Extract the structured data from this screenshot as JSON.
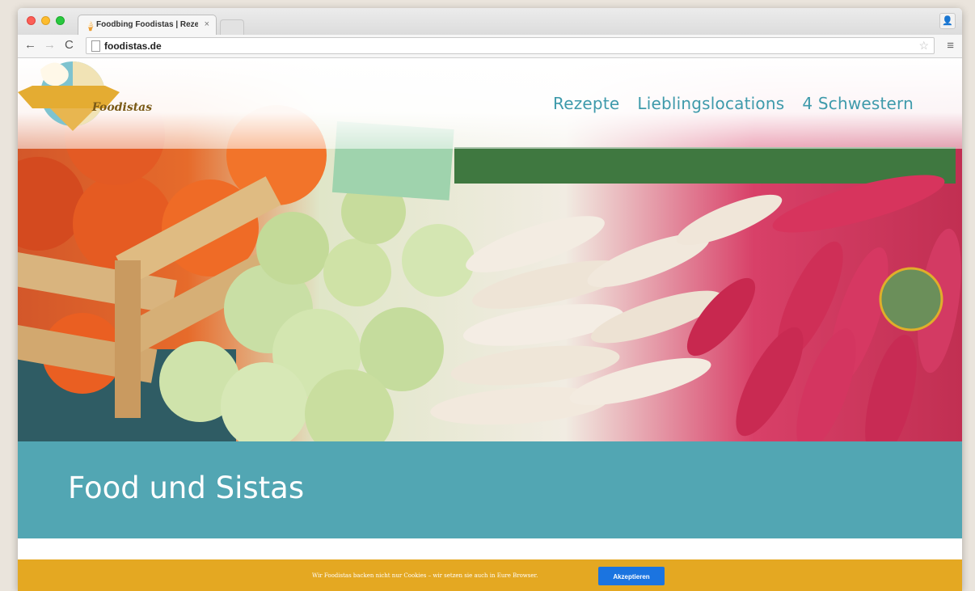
{
  "browser": {
    "tab_title": "Foodbing Foodistas | Rezepte",
    "tab_close": "×",
    "favicon": "🍦",
    "url": "foodistas.de",
    "icons": [
      "back-arrow-icon",
      "forward-arrow-icon",
      "reload-icon",
      "page-icon",
      "star-icon",
      "menu-icon",
      "profile-icon"
    ]
  },
  "site": {
    "logo_text": "Foodistas",
    "nav": [
      "Rezepte",
      "Lieblingslocations",
      "4 Schwestern"
    ],
    "page_title": "Food und Sistas",
    "colors": {
      "teal": "#52a6b3",
      "nav": "#3e9aab",
      "cookie_bar": "#e4a822",
      "button": "#1b74e0"
    }
  },
  "cookie": {
    "text": "Wir Foodistas backen nicht nur Cookies – wir setzen sie auch in Eure Browser.",
    "button": "Akzeptieren"
  }
}
